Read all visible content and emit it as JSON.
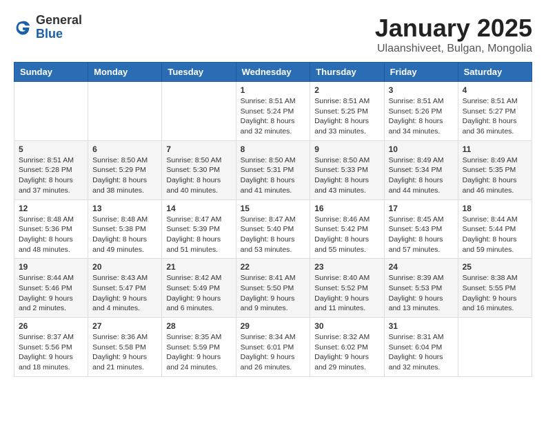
{
  "logo": {
    "general": "General",
    "blue": "Blue"
  },
  "title": "January 2025",
  "location": "Ulaanshiveet, Bulgan, Mongolia",
  "weekdays": [
    "Sunday",
    "Monday",
    "Tuesday",
    "Wednesday",
    "Thursday",
    "Friday",
    "Saturday"
  ],
  "weeks": [
    [
      {
        "day": "",
        "info": ""
      },
      {
        "day": "",
        "info": ""
      },
      {
        "day": "",
        "info": ""
      },
      {
        "day": "1",
        "info": "Sunrise: 8:51 AM\nSunset: 5:24 PM\nDaylight: 8 hours and 32 minutes."
      },
      {
        "day": "2",
        "info": "Sunrise: 8:51 AM\nSunset: 5:25 PM\nDaylight: 8 hours and 33 minutes."
      },
      {
        "day": "3",
        "info": "Sunrise: 8:51 AM\nSunset: 5:26 PM\nDaylight: 8 hours and 34 minutes."
      },
      {
        "day": "4",
        "info": "Sunrise: 8:51 AM\nSunset: 5:27 PM\nDaylight: 8 hours and 36 minutes."
      }
    ],
    [
      {
        "day": "5",
        "info": "Sunrise: 8:51 AM\nSunset: 5:28 PM\nDaylight: 8 hours and 37 minutes."
      },
      {
        "day": "6",
        "info": "Sunrise: 8:50 AM\nSunset: 5:29 PM\nDaylight: 8 hours and 38 minutes."
      },
      {
        "day": "7",
        "info": "Sunrise: 8:50 AM\nSunset: 5:30 PM\nDaylight: 8 hours and 40 minutes."
      },
      {
        "day": "8",
        "info": "Sunrise: 8:50 AM\nSunset: 5:31 PM\nDaylight: 8 hours and 41 minutes."
      },
      {
        "day": "9",
        "info": "Sunrise: 8:50 AM\nSunset: 5:33 PM\nDaylight: 8 hours and 43 minutes."
      },
      {
        "day": "10",
        "info": "Sunrise: 8:49 AM\nSunset: 5:34 PM\nDaylight: 8 hours and 44 minutes."
      },
      {
        "day": "11",
        "info": "Sunrise: 8:49 AM\nSunset: 5:35 PM\nDaylight: 8 hours and 46 minutes."
      }
    ],
    [
      {
        "day": "12",
        "info": "Sunrise: 8:48 AM\nSunset: 5:36 PM\nDaylight: 8 hours and 48 minutes."
      },
      {
        "day": "13",
        "info": "Sunrise: 8:48 AM\nSunset: 5:38 PM\nDaylight: 8 hours and 49 minutes."
      },
      {
        "day": "14",
        "info": "Sunrise: 8:47 AM\nSunset: 5:39 PM\nDaylight: 8 hours and 51 minutes."
      },
      {
        "day": "15",
        "info": "Sunrise: 8:47 AM\nSunset: 5:40 PM\nDaylight: 8 hours and 53 minutes."
      },
      {
        "day": "16",
        "info": "Sunrise: 8:46 AM\nSunset: 5:42 PM\nDaylight: 8 hours and 55 minutes."
      },
      {
        "day": "17",
        "info": "Sunrise: 8:45 AM\nSunset: 5:43 PM\nDaylight: 8 hours and 57 minutes."
      },
      {
        "day": "18",
        "info": "Sunrise: 8:44 AM\nSunset: 5:44 PM\nDaylight: 8 hours and 59 minutes."
      }
    ],
    [
      {
        "day": "19",
        "info": "Sunrise: 8:44 AM\nSunset: 5:46 PM\nDaylight: 9 hours and 2 minutes."
      },
      {
        "day": "20",
        "info": "Sunrise: 8:43 AM\nSunset: 5:47 PM\nDaylight: 9 hours and 4 minutes."
      },
      {
        "day": "21",
        "info": "Sunrise: 8:42 AM\nSunset: 5:49 PM\nDaylight: 9 hours and 6 minutes."
      },
      {
        "day": "22",
        "info": "Sunrise: 8:41 AM\nSunset: 5:50 PM\nDaylight: 9 hours and 9 minutes."
      },
      {
        "day": "23",
        "info": "Sunrise: 8:40 AM\nSunset: 5:52 PM\nDaylight: 9 hours and 11 minutes."
      },
      {
        "day": "24",
        "info": "Sunrise: 8:39 AM\nSunset: 5:53 PM\nDaylight: 9 hours and 13 minutes."
      },
      {
        "day": "25",
        "info": "Sunrise: 8:38 AM\nSunset: 5:55 PM\nDaylight: 9 hours and 16 minutes."
      }
    ],
    [
      {
        "day": "26",
        "info": "Sunrise: 8:37 AM\nSunset: 5:56 PM\nDaylight: 9 hours and 18 minutes."
      },
      {
        "day": "27",
        "info": "Sunrise: 8:36 AM\nSunset: 5:58 PM\nDaylight: 9 hours and 21 minutes."
      },
      {
        "day": "28",
        "info": "Sunrise: 8:35 AM\nSunset: 5:59 PM\nDaylight: 9 hours and 24 minutes."
      },
      {
        "day": "29",
        "info": "Sunrise: 8:34 AM\nSunset: 6:01 PM\nDaylight: 9 hours and 26 minutes."
      },
      {
        "day": "30",
        "info": "Sunrise: 8:32 AM\nSunset: 6:02 PM\nDaylight: 9 hours and 29 minutes."
      },
      {
        "day": "31",
        "info": "Sunrise: 8:31 AM\nSunset: 6:04 PM\nDaylight: 9 hours and 32 minutes."
      },
      {
        "day": "",
        "info": ""
      }
    ]
  ]
}
